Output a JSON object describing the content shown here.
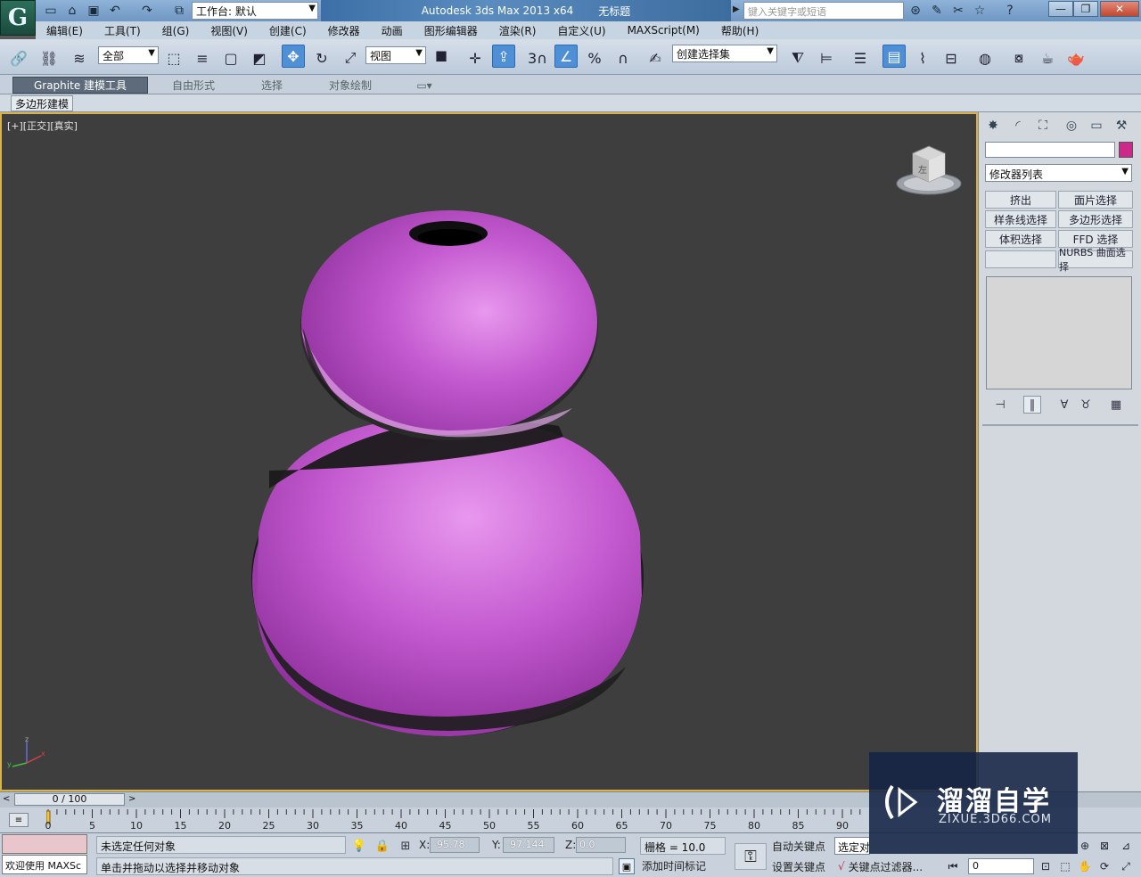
{
  "titlebar": {
    "workspace": "工作台: 默认",
    "app_name": "Autodesk 3ds Max  2013 x64",
    "doc_title": "无标题",
    "search_placeholder": "键入关键字或短语"
  },
  "menu": [
    "编辑(E)",
    "工具(T)",
    "组(G)",
    "视图(V)",
    "创建(C)",
    "修改器",
    "动画",
    "图形编辑器",
    "渲染(R)",
    "自定义(U)",
    "MAXScript(M)",
    "帮助(H)"
  ],
  "toolbar": {
    "selection_filter": "全部",
    "ref_coord": "视图",
    "snap_label": "3",
    "named_selection": "创建选择集"
  },
  "ribbon": {
    "tabs": [
      "Graphite 建模工具",
      "自由形式",
      "选择",
      "对象绘制"
    ],
    "subtab": "多边形建模"
  },
  "viewport": {
    "label": "[+][正交][真实]",
    "object_color": "#c452d2",
    "background": "#3e3e3e",
    "cube_face": "左"
  },
  "command_panel": {
    "modifier_list": "修改器列表",
    "object_color": "#cc2a8a",
    "buttons": [
      "挤出",
      "面片选择",
      "样条线选择",
      "多边形选择",
      "体积选择",
      "FFD 选择",
      "",
      "NURBS 曲面选择"
    ]
  },
  "timeline": {
    "slider": "0 / 100",
    "ticks": [
      "0",
      "5",
      "10",
      "15",
      "20",
      "25",
      "30",
      "35",
      "40",
      "45",
      "50",
      "55",
      "60",
      "65",
      "70",
      "75",
      "80",
      "85",
      "90"
    ]
  },
  "status": {
    "welcome": "欢迎使用 MAXSc",
    "line1": "未选定任何对象",
    "line2": "单击并拖动以选择并移动对象",
    "x_label": "X:",
    "x": "-95.78",
    "y_label": "Y:",
    "y": "-97.144",
    "z_label": "Z:",
    "z": "0.0",
    "grid": "栅格 = 10.0",
    "add_time_tag": "添加时间标记",
    "auto_key": "自动关键点",
    "set_key": "设置关键点",
    "selected": "选定对",
    "key_filters": "关键点过滤器...",
    "frame": "0"
  },
  "watermark": {
    "title": "溜溜自学",
    "url": "ZIXUE.3D66.COM"
  }
}
